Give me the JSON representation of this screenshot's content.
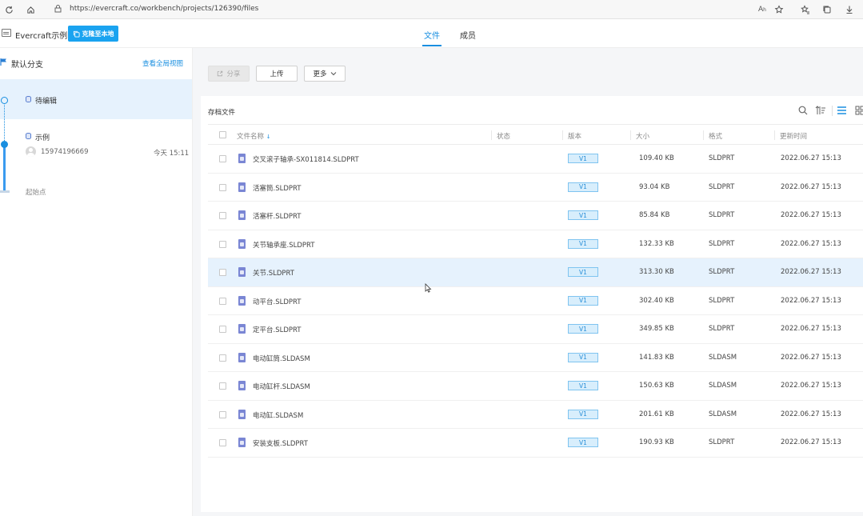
{
  "browser": {
    "url": "https://evercraft.co/workbench/projects/126390/files",
    "icons": [
      "refresh-icon",
      "home-icon",
      "lock-icon",
      "read-aloud-icon",
      "favorite-icon",
      "favorites-icon",
      "collections-icon",
      "download-icon"
    ]
  },
  "header": {
    "app_name": "Evercraft示例",
    "clone_label": "克隆至本地",
    "tabs": [
      {
        "label": "文件",
        "active": true
      },
      {
        "label": "成员",
        "active": false
      }
    ]
  },
  "sidebar": {
    "branch_title": "默认分支",
    "view_all": "查看全局视图",
    "nodes": [
      {
        "label": "待编辑"
      },
      {
        "label": "示例",
        "user": "15974196669",
        "time": "今天 15:11"
      }
    ],
    "start_label": "起始点"
  },
  "toolbar": {
    "share_label": "分享",
    "upload_label": "上传",
    "more_label": "更多"
  },
  "files": {
    "section_title": "存档文件",
    "columns": [
      "文件名称",
      "状态",
      "版本",
      "大小",
      "格式",
      "更新时间"
    ],
    "rows": [
      {
        "name": "交叉滚子轴承-SX011814.SLDPRT",
        "status": "",
        "version": "V1",
        "size": "109.40 KB",
        "format": "SLDPRT",
        "updated": "2022.06.27 15:13"
      },
      {
        "name": "活塞筒.SLDPRT",
        "status": "",
        "version": "V1",
        "size": "93.04 KB",
        "format": "SLDPRT",
        "updated": "2022.06.27 15:13"
      },
      {
        "name": "活塞杆.SLDPRT",
        "status": "",
        "version": "V1",
        "size": "85.84 KB",
        "format": "SLDPRT",
        "updated": "2022.06.27 15:13"
      },
      {
        "name": "关节轴承座.SLDPRT",
        "status": "",
        "version": "V1",
        "size": "132.33 KB",
        "format": "SLDPRT",
        "updated": "2022.06.27 15:13"
      },
      {
        "name": "关节.SLDPRT",
        "status": "",
        "version": "V1",
        "size": "313.30 KB",
        "format": "SLDPRT",
        "updated": "2022.06.27 15:13"
      },
      {
        "name": "动平台.SLDPRT",
        "status": "",
        "version": "V1",
        "size": "302.40 KB",
        "format": "SLDPRT",
        "updated": "2022.06.27 15:13"
      },
      {
        "name": "定平台.SLDPRT",
        "status": "",
        "version": "V1",
        "size": "349.85 KB",
        "format": "SLDPRT",
        "updated": "2022.06.27 15:13"
      },
      {
        "name": "电动缸筒.SLDASM",
        "status": "",
        "version": "V1",
        "size": "141.83 KB",
        "format": "SLDASM",
        "updated": "2022.06.27 15:13"
      },
      {
        "name": "电动缸杆.SLDASM",
        "status": "",
        "version": "V1",
        "size": "150.63 KB",
        "format": "SLDASM",
        "updated": "2022.06.27 15:13"
      },
      {
        "name": "电动缸.SLDASM",
        "status": "",
        "version": "V1",
        "size": "201.61 KB",
        "format": "SLDASM",
        "updated": "2022.06.27 15:13"
      },
      {
        "name": "安装支板.SLDPRT",
        "status": "",
        "version": "V1",
        "size": "190.93 KB",
        "format": "SLDPRT",
        "updated": "2022.06.27 15:13"
      }
    ]
  },
  "colors": {
    "accent": "#1a8fe0",
    "clone_button": "#1aa3f0",
    "selected_row": "#e6f2fd",
    "file_icon": "#7a86d4"
  }
}
